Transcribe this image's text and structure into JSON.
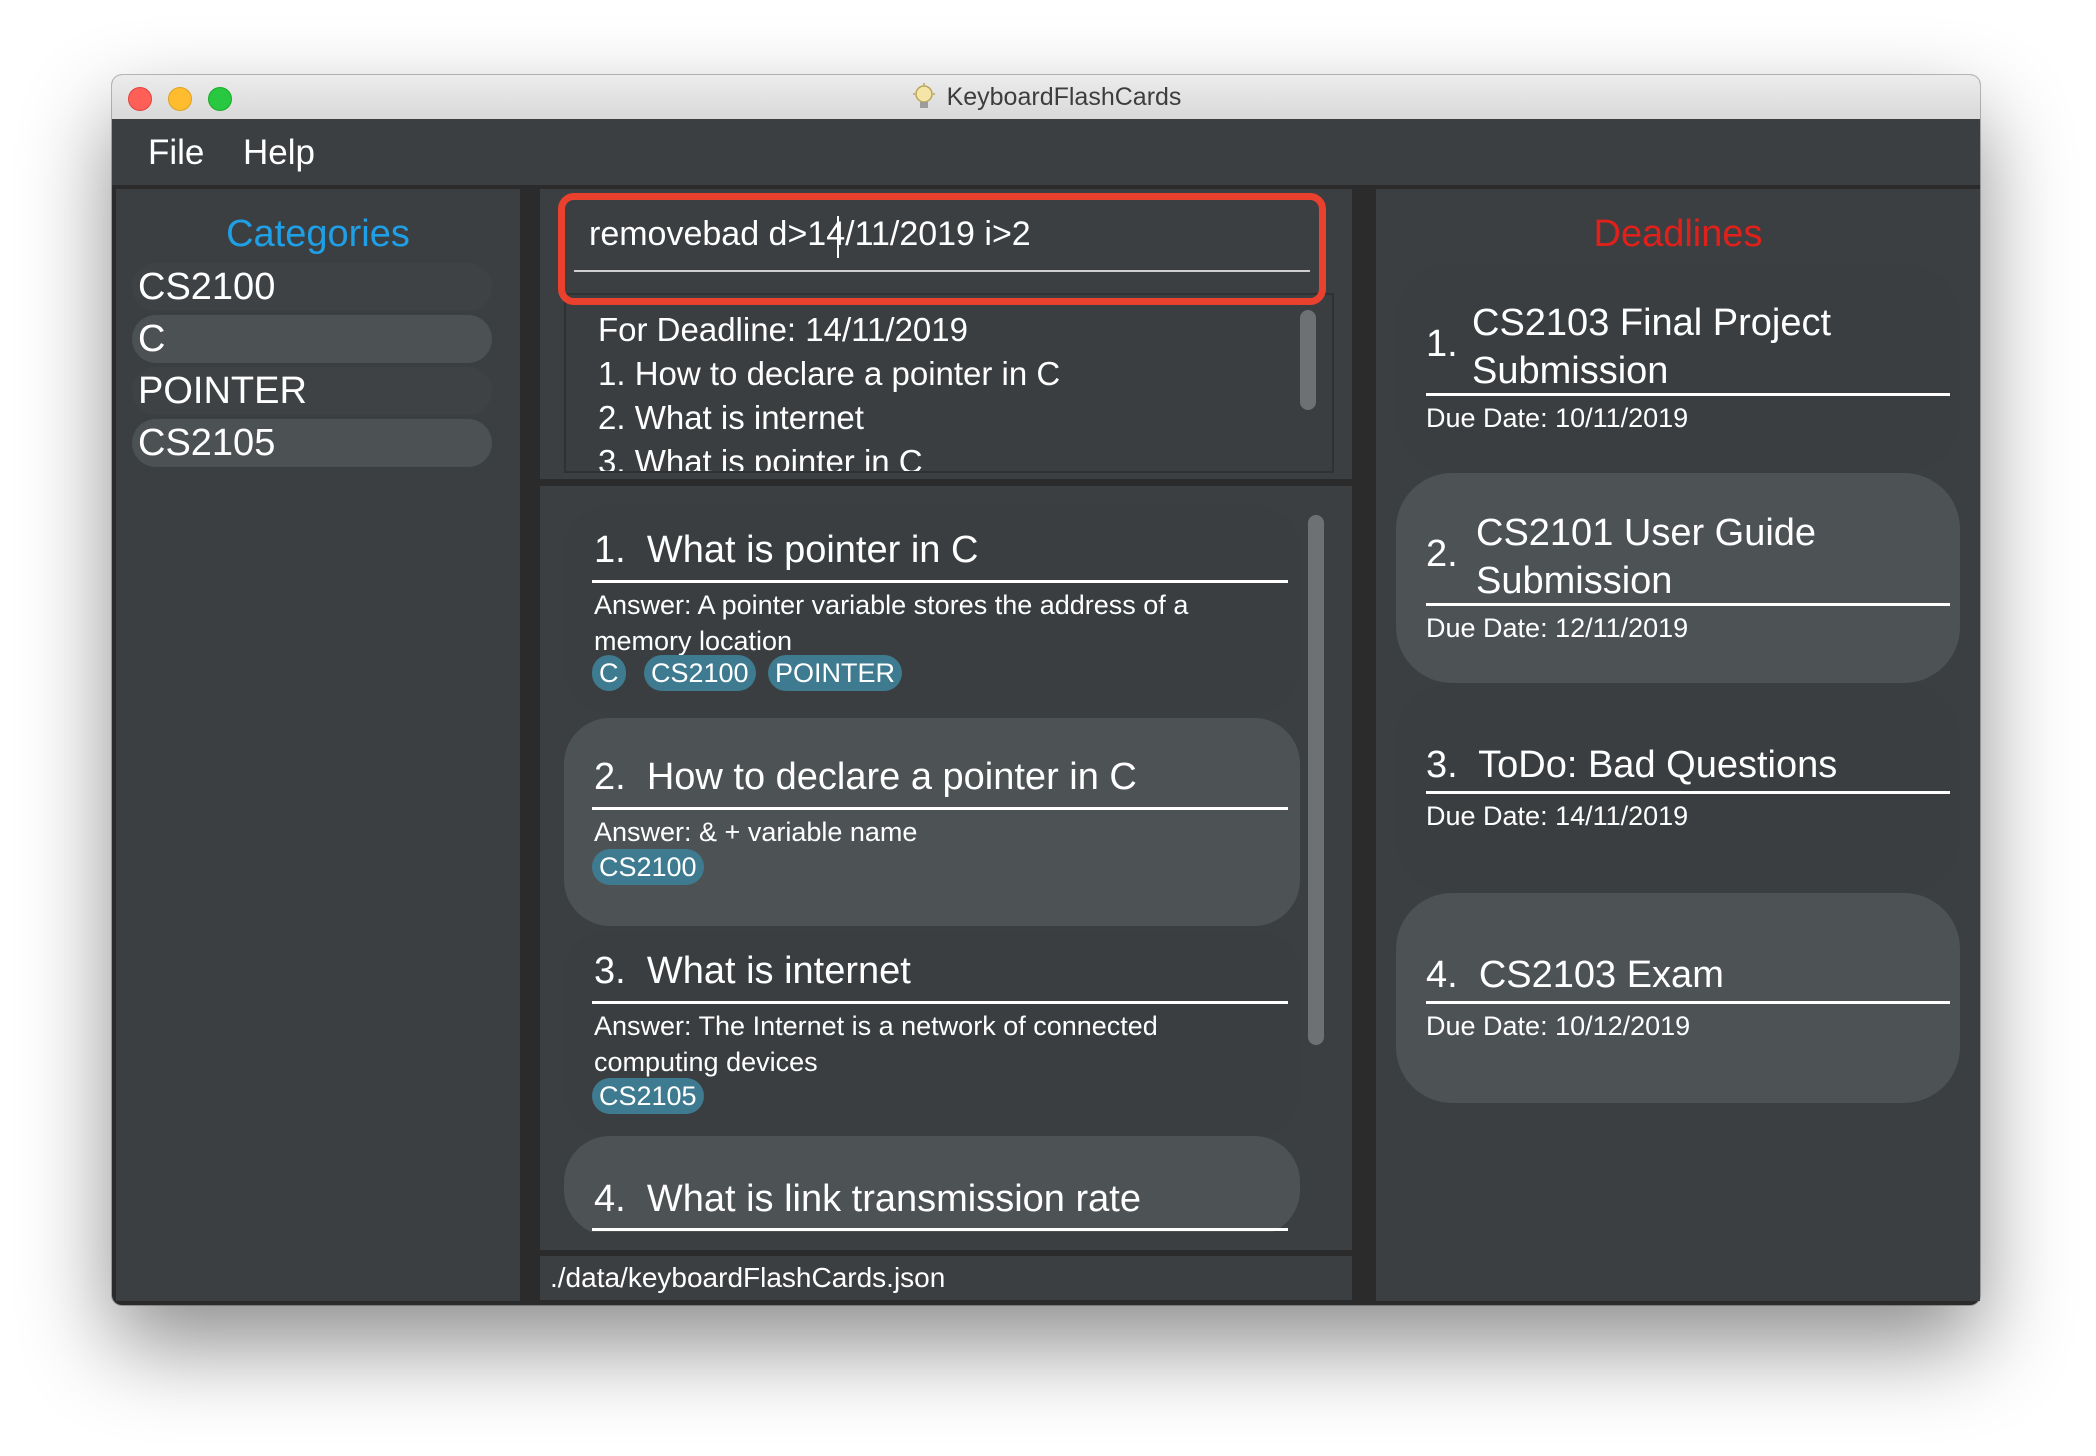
{
  "window": {
    "title": "KeyboardFlashCards"
  },
  "menu": {
    "file": "File",
    "help": "Help"
  },
  "categories": {
    "title": "Categories",
    "items": [
      "CS2100",
      "C",
      "POINTER",
      "CS2105"
    ]
  },
  "command": {
    "value": "removebad d>14/11/2019 i>2"
  },
  "result": {
    "lines": [
      "For Deadline: 14/11/2019",
      "1. How to declare a pointer in C",
      "2. What is internet",
      "3. What is pointer in C"
    ]
  },
  "flashcards": [
    {
      "index": "1.",
      "question": "What is pointer in C",
      "answer": "Answer: A pointer variable stores the address of a memory location",
      "tags": [
        "C",
        "CS2100",
        "POINTER"
      ]
    },
    {
      "index": "2.",
      "question": "How to declare a pointer in C",
      "answer": "Answer: & + variable name",
      "tags": [
        "CS2100"
      ]
    },
    {
      "index": "3.",
      "question": "What is internet",
      "answer": "Answer: The Internet is a network of connected computing devices",
      "tags": [
        "CS2105"
      ]
    },
    {
      "index": "4.",
      "question": "What is link transmission rate"
    }
  ],
  "status": {
    "path": "./data/keyboardFlashCards.json"
  },
  "deadlines": {
    "title": "Deadlines",
    "items": [
      {
        "index": "1.",
        "title_line1": "CS2103 Final Project",
        "title_line2": "Submission",
        "due": "Due Date: 10/11/2019"
      },
      {
        "index": "2.",
        "title_line1": "CS2101 User Guide",
        "title_line2": "Submission",
        "due": "Due Date: 12/11/2019"
      },
      {
        "index": "3.",
        "title_line1": "ToDo: Bad Questions",
        "due": "Due Date: 14/11/2019"
      },
      {
        "index": "4.",
        "title_line1": "CS2103 Exam",
        "due": "Due Date: 10/12/2019"
      }
    ]
  },
  "colors": {
    "categories_title": "#1e9fe6",
    "deadlines_title": "#e0201b",
    "command_highlight": "#e9412d",
    "tag_bg": "#3e7b91"
  }
}
